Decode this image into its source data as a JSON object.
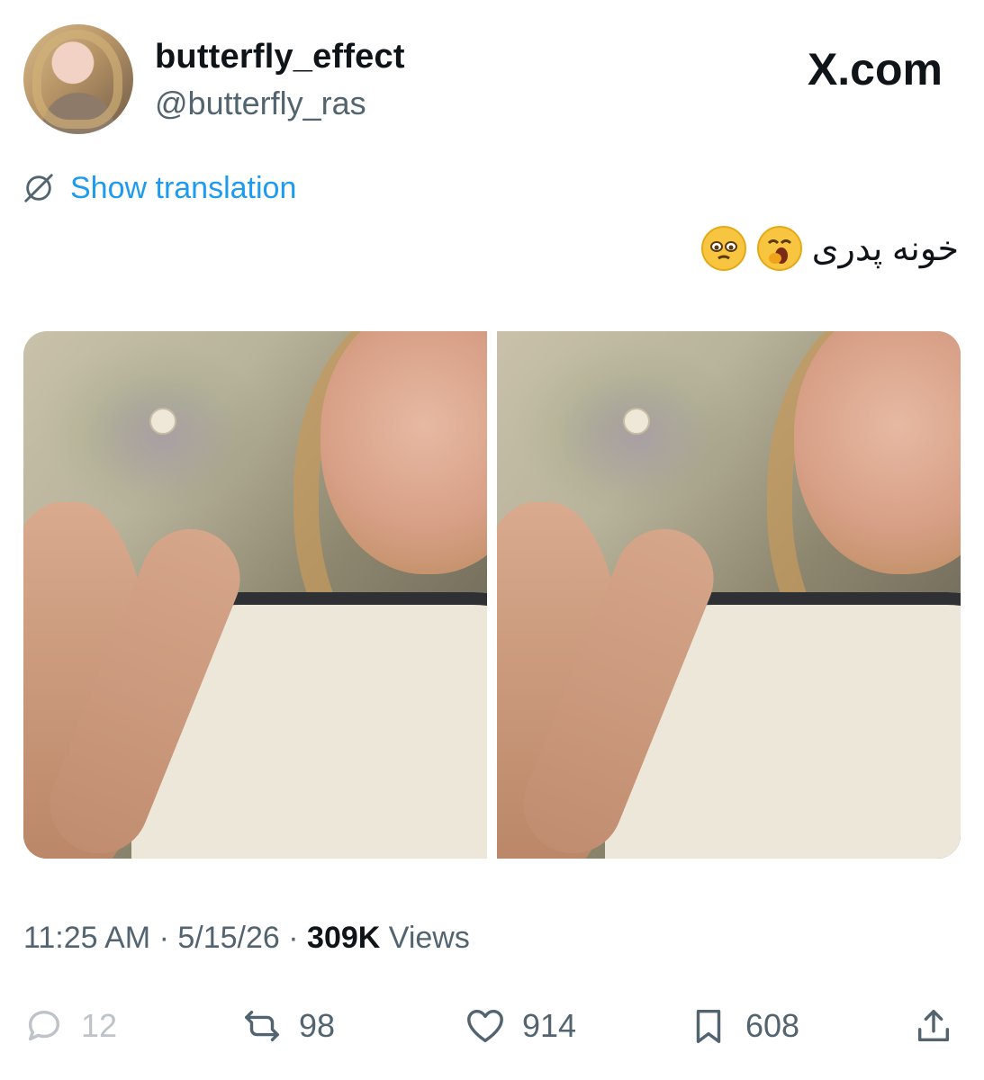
{
  "author": {
    "display_name": "butterfly_effect",
    "handle": "@butterfly_ras",
    "avatar_icon": "profile-photo"
  },
  "brand_label": "X.com",
  "translation": {
    "label": "Show translation",
    "icon": "translate-globe-icon"
  },
  "tweet": {
    "text": "خونه پدری",
    "emojis": [
      "yawning-face-emoji",
      "pleading-face-emoji"
    ]
  },
  "media": {
    "photos": [
      {
        "name": "photo-1"
      },
      {
        "name": "photo-2"
      }
    ]
  },
  "meta": {
    "time": "11:25 AM",
    "separator1": " · ",
    "date": "5/15/26",
    "separator2": " · ",
    "views_count": "309K",
    "views_label": " Views"
  },
  "actions": {
    "reply": {
      "icon": "reply-icon",
      "count": "12"
    },
    "repost": {
      "icon": "repost-icon",
      "count": "98"
    },
    "like": {
      "icon": "heart-icon",
      "count": "914"
    },
    "bookmark": {
      "icon": "bookmark-icon",
      "count": "608"
    },
    "share": {
      "icon": "share-icon"
    }
  },
  "colors": {
    "accent_blue": "#1d9bf0",
    "secondary_text": "#536471",
    "primary_text": "#0f1419"
  }
}
